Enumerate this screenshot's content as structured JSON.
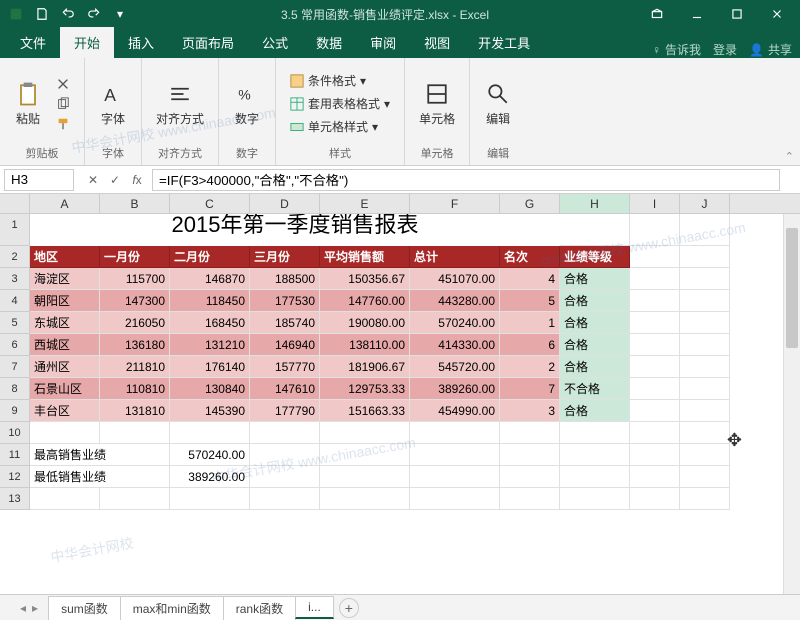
{
  "titlebar": {
    "filename": "3.5 常用函数-销售业绩评定.xlsx - Excel"
  },
  "tabs": {
    "items": [
      "文件",
      "开始",
      "插入",
      "页面布局",
      "公式",
      "数据",
      "审阅",
      "视图",
      "开发工具"
    ],
    "active": 1,
    "tell_me": "告诉我",
    "signin": "登录",
    "share": "共享"
  },
  "ribbon": {
    "clipboard": {
      "paste": "粘贴",
      "label": "剪贴板"
    },
    "font": {
      "btn": "字体",
      "label": "字体"
    },
    "align": {
      "btn": "对齐方式",
      "label": "对齐方式"
    },
    "number": {
      "btn": "数字",
      "label": "数字"
    },
    "styles": {
      "cond": "条件格式",
      "table": "套用表格格式",
      "cell": "单元格样式",
      "label": "样式"
    },
    "cells": {
      "btn": "单元格",
      "label": "单元格"
    },
    "editing": {
      "btn": "编辑",
      "label": "编辑"
    }
  },
  "namebox": "H3",
  "formula": "=IF(F3>400000,\"合格\",\"不合格\")",
  "columns": [
    "A",
    "B",
    "C",
    "D",
    "E",
    "F",
    "G",
    "H",
    "I",
    "J"
  ],
  "sheet_title": "2015年第一季度销售报表",
  "headers": [
    "地区",
    "一月份",
    "二月份",
    "三月份",
    "平均销售额",
    "总计",
    "名次",
    "业绩等级"
  ],
  "rows": [
    {
      "region": "海淀区",
      "m1": "115700",
      "m2": "146870",
      "m3": "188500",
      "avg": "150356.67",
      "total": "451070.00",
      "rank": "4",
      "grade": "合格"
    },
    {
      "region": "朝阳区",
      "m1": "147300",
      "m2": "118450",
      "m3": "177530",
      "avg": "147760.00",
      "total": "443280.00",
      "rank": "5",
      "grade": "合格"
    },
    {
      "region": "东城区",
      "m1": "216050",
      "m2": "168450",
      "m3": "185740",
      "avg": "190080.00",
      "total": "570240.00",
      "rank": "1",
      "grade": "合格"
    },
    {
      "region": "西城区",
      "m1": "136180",
      "m2": "131210",
      "m3": "146940",
      "avg": "138110.00",
      "total": "414330.00",
      "rank": "6",
      "grade": "合格"
    },
    {
      "region": "通州区",
      "m1": "211810",
      "m2": "176140",
      "m3": "157770",
      "avg": "181906.67",
      "total": "545720.00",
      "rank": "2",
      "grade": "合格"
    },
    {
      "region": "石景山区",
      "m1": "110810",
      "m2": "130840",
      "m3": "147610",
      "avg": "129753.33",
      "total": "389260.00",
      "rank": "7",
      "grade": "不合格"
    },
    {
      "region": "丰台区",
      "m1": "131810",
      "m2": "145390",
      "m3": "177790",
      "avg": "151663.33",
      "total": "454990.00",
      "rank": "3",
      "grade": "合格"
    }
  ],
  "summary": {
    "max_label": "最高销售业绩",
    "max_val": "570240.00",
    "min_label": "最低销售业绩",
    "min_val": "389260.00"
  },
  "sheet_tabs": {
    "items": [
      "sum函数",
      "max和min函数",
      "rank函数",
      "i..."
    ],
    "active": 3
  }
}
